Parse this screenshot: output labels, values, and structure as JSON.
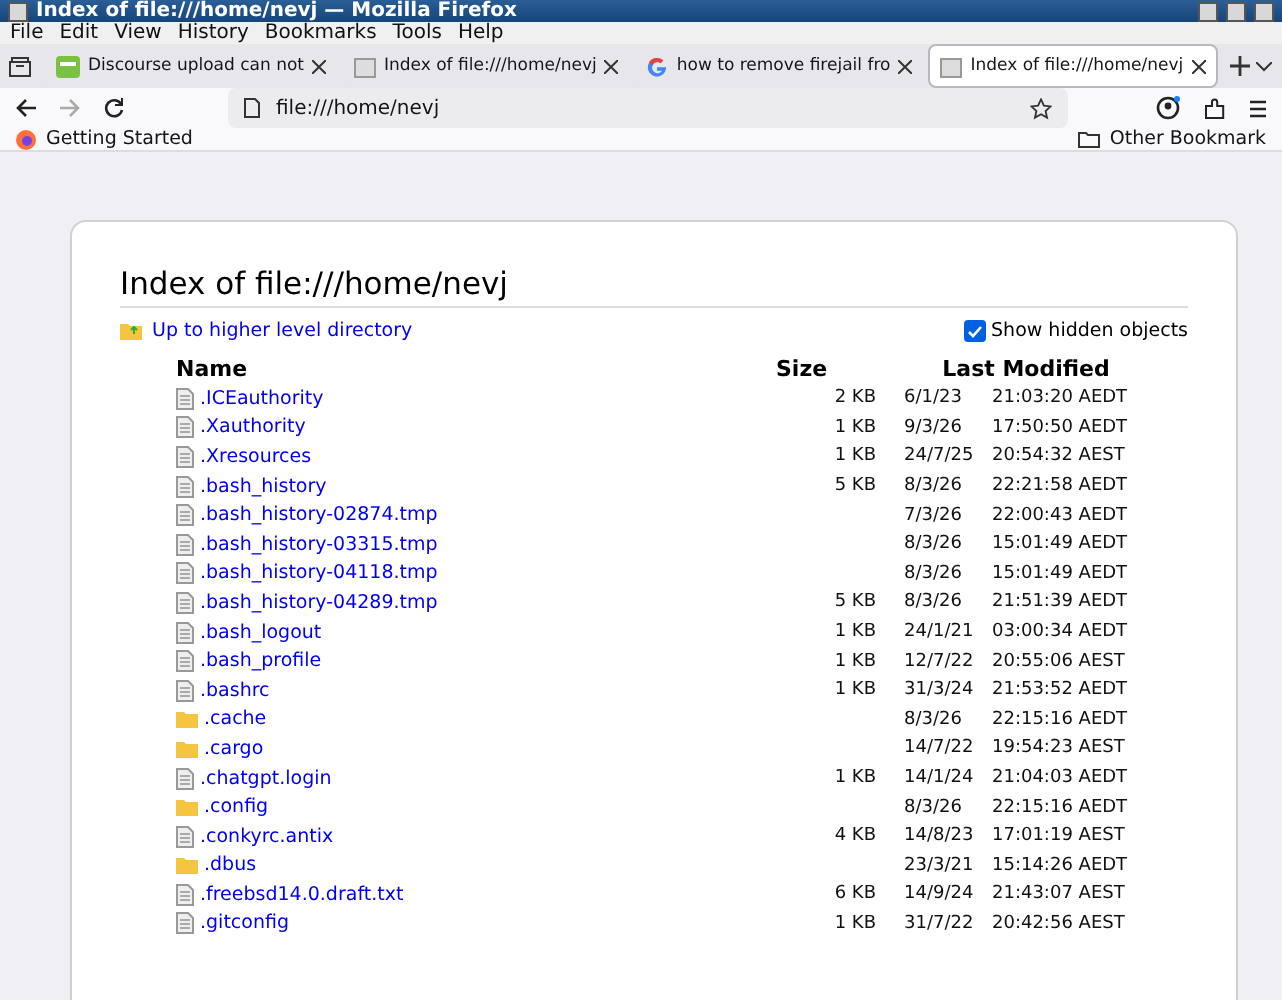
{
  "window": {
    "title": "Index of file:///home/nevj — Mozilla Firefox"
  },
  "menu": [
    "File",
    "Edit",
    "View",
    "History",
    "Bookmarks",
    "Tools",
    "Help"
  ],
  "tabs": [
    {
      "label": "Discourse upload can not",
      "selected": false,
      "kind": "discourse"
    },
    {
      "label": "Index of file:///home/nevj",
      "selected": false,
      "kind": "file"
    },
    {
      "label": "how to remove firejail fro",
      "selected": false,
      "kind": "google"
    },
    {
      "label": "Index of file:///home/nevj",
      "selected": true,
      "kind": "file"
    }
  ],
  "address": {
    "value": "file:///home/nevj"
  },
  "bookmarks": {
    "items": [
      "Getting Started"
    ],
    "other": "Other Bookmark"
  },
  "page": {
    "heading": "Index of file:///home/nevj",
    "up_link": "Up to higher level directory",
    "show_hidden": {
      "label": "Show hidden objects",
      "checked": true
    },
    "columns": [
      "Name",
      "Size",
      "Last Modified"
    ],
    "rows": [
      {
        "kind": "file",
        "name": ".ICEauthority",
        "size": "2 KB",
        "date": "6/1/23",
        "time": "21:03:20 AEDT"
      },
      {
        "kind": "file",
        "name": ".Xauthority",
        "size": "1 KB",
        "date": "9/3/26",
        "time": "17:50:50 AEDT"
      },
      {
        "kind": "file",
        "name": ".Xresources",
        "size": "1 KB",
        "date": "24/7/25",
        "time": "20:54:32 AEST"
      },
      {
        "kind": "file",
        "name": ".bash_history",
        "size": "5 KB",
        "date": "8/3/26",
        "time": "22:21:58 AEDT"
      },
      {
        "kind": "file",
        "name": ".bash_history-02874.tmp",
        "date": "7/3/26",
        "time": "22:00:43 AEDT"
      },
      {
        "kind": "file",
        "name": ".bash_history-03315.tmp",
        "date": "8/3/26",
        "time": "15:01:49 AEDT"
      },
      {
        "kind": "file",
        "name": ".bash_history-04118.tmp",
        "date": "8/3/26",
        "time": "15:01:49 AEDT"
      },
      {
        "kind": "file",
        "name": ".bash_history-04289.tmp",
        "size": "5 KB",
        "date": "8/3/26",
        "time": "21:51:39 AEDT"
      },
      {
        "kind": "file",
        "name": ".bash_logout",
        "size": "1 KB",
        "date": "24/1/21",
        "time": "03:00:34 AEDT"
      },
      {
        "kind": "file",
        "name": ".bash_profile",
        "size": "1 KB",
        "date": "12/7/22",
        "time": "20:55:06 AEST"
      },
      {
        "kind": "file",
        "name": ".bashrc",
        "size": "1 KB",
        "date": "31/3/24",
        "time": "21:53:52 AEDT"
      },
      {
        "kind": "folder",
        "name": ".cache",
        "date": "8/3/26",
        "time": "22:15:16 AEDT"
      },
      {
        "kind": "folder",
        "name": ".cargo",
        "date": "14/7/22",
        "time": "19:54:23 AEST"
      },
      {
        "kind": "file",
        "name": ".chatgpt.login",
        "size": "1 KB",
        "date": "14/1/24",
        "time": "21:04:03 AEDT"
      },
      {
        "kind": "folder",
        "name": ".config",
        "date": "8/3/26",
        "time": "22:15:16 AEDT"
      },
      {
        "kind": "file",
        "name": ".conkyrc.antix",
        "size": "4 KB",
        "date": "14/8/23",
        "time": "17:01:19 AEST"
      },
      {
        "kind": "folder",
        "name": ".dbus",
        "date": "23/3/21",
        "time": "15:14:26 AEDT"
      },
      {
        "kind": "file",
        "name": ".freebsd14.0.draft.txt",
        "size": "6 KB",
        "date": "14/9/24",
        "time": "21:43:07 AEST"
      },
      {
        "kind": "file",
        "name": ".gitconfig",
        "size": "1 KB",
        "date": "31/7/22",
        "time": "20:42:56 AEST"
      }
    ]
  }
}
